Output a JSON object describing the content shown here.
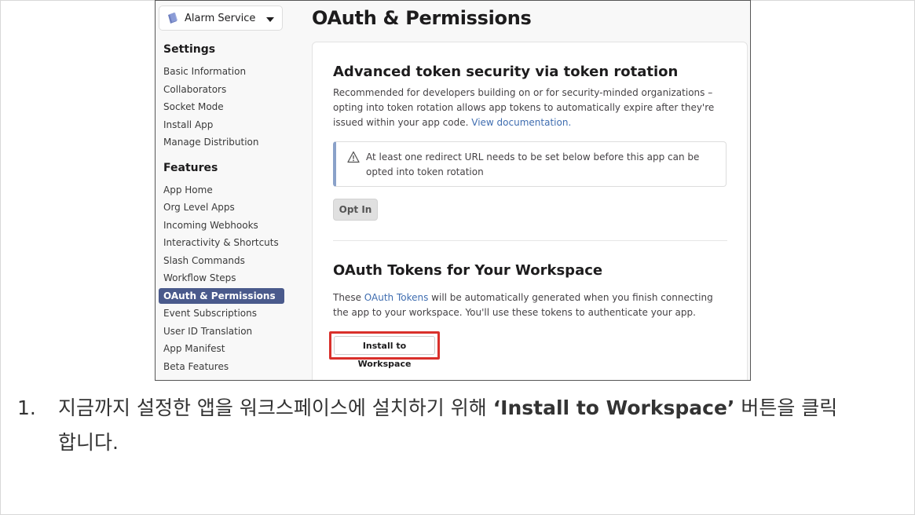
{
  "app": {
    "name": "Alarm Service",
    "page_title": "OAuth & Permissions"
  },
  "sidebar": {
    "settings_heading": "Settings",
    "settings_items": [
      {
        "label": "Basic Information"
      },
      {
        "label": "Collaborators"
      },
      {
        "label": "Socket Mode"
      },
      {
        "label": "Install App"
      },
      {
        "label": "Manage Distribution"
      }
    ],
    "features_heading": "Features",
    "features_items": [
      {
        "label": "App Home"
      },
      {
        "label": "Org Level Apps"
      },
      {
        "label": "Incoming Webhooks"
      },
      {
        "label": "Interactivity & Shortcuts"
      },
      {
        "label": "Slash Commands"
      },
      {
        "label": "Workflow Steps"
      },
      {
        "label": "OAuth & Permissions",
        "active": true
      },
      {
        "label": "Event Subscriptions"
      },
      {
        "label": "User ID Translation"
      },
      {
        "label": "App Manifest"
      },
      {
        "label": "Beta Features"
      }
    ]
  },
  "token_rotation": {
    "heading": "Advanced token security via token rotation",
    "body": "Recommended for developers building on or for security-minded organizations – opting into token rotation allows app tokens to automatically expire after they're issued within your app code.",
    "link": "View documentation.",
    "alert": "At least one redirect URL needs to be set below before this app can be opted into token rotation",
    "opt_in_label": "Opt In"
  },
  "oauth_tokens": {
    "heading": "OAuth Tokens for Your Workspace",
    "body_prefix": "These ",
    "link": "OAuth Tokens",
    "body_suffix": " will be automatically generated when you finish connecting the app to your workspace. You'll use these tokens to authenticate your app.",
    "install_label": "Install to Workspace"
  },
  "caption": {
    "number": "1.",
    "before": "지금까지 설정한 앱을 워크스페이스에 설치하기 위해 ",
    "strong": "‘Install to Workspace’",
    "after": " 버튼을 클릭합니다."
  },
  "colors": {
    "active_nav": "#4a5a8c",
    "link": "#3f6db0",
    "highlight": "#d9302b",
    "alert_accent": "#8aa1c9"
  }
}
